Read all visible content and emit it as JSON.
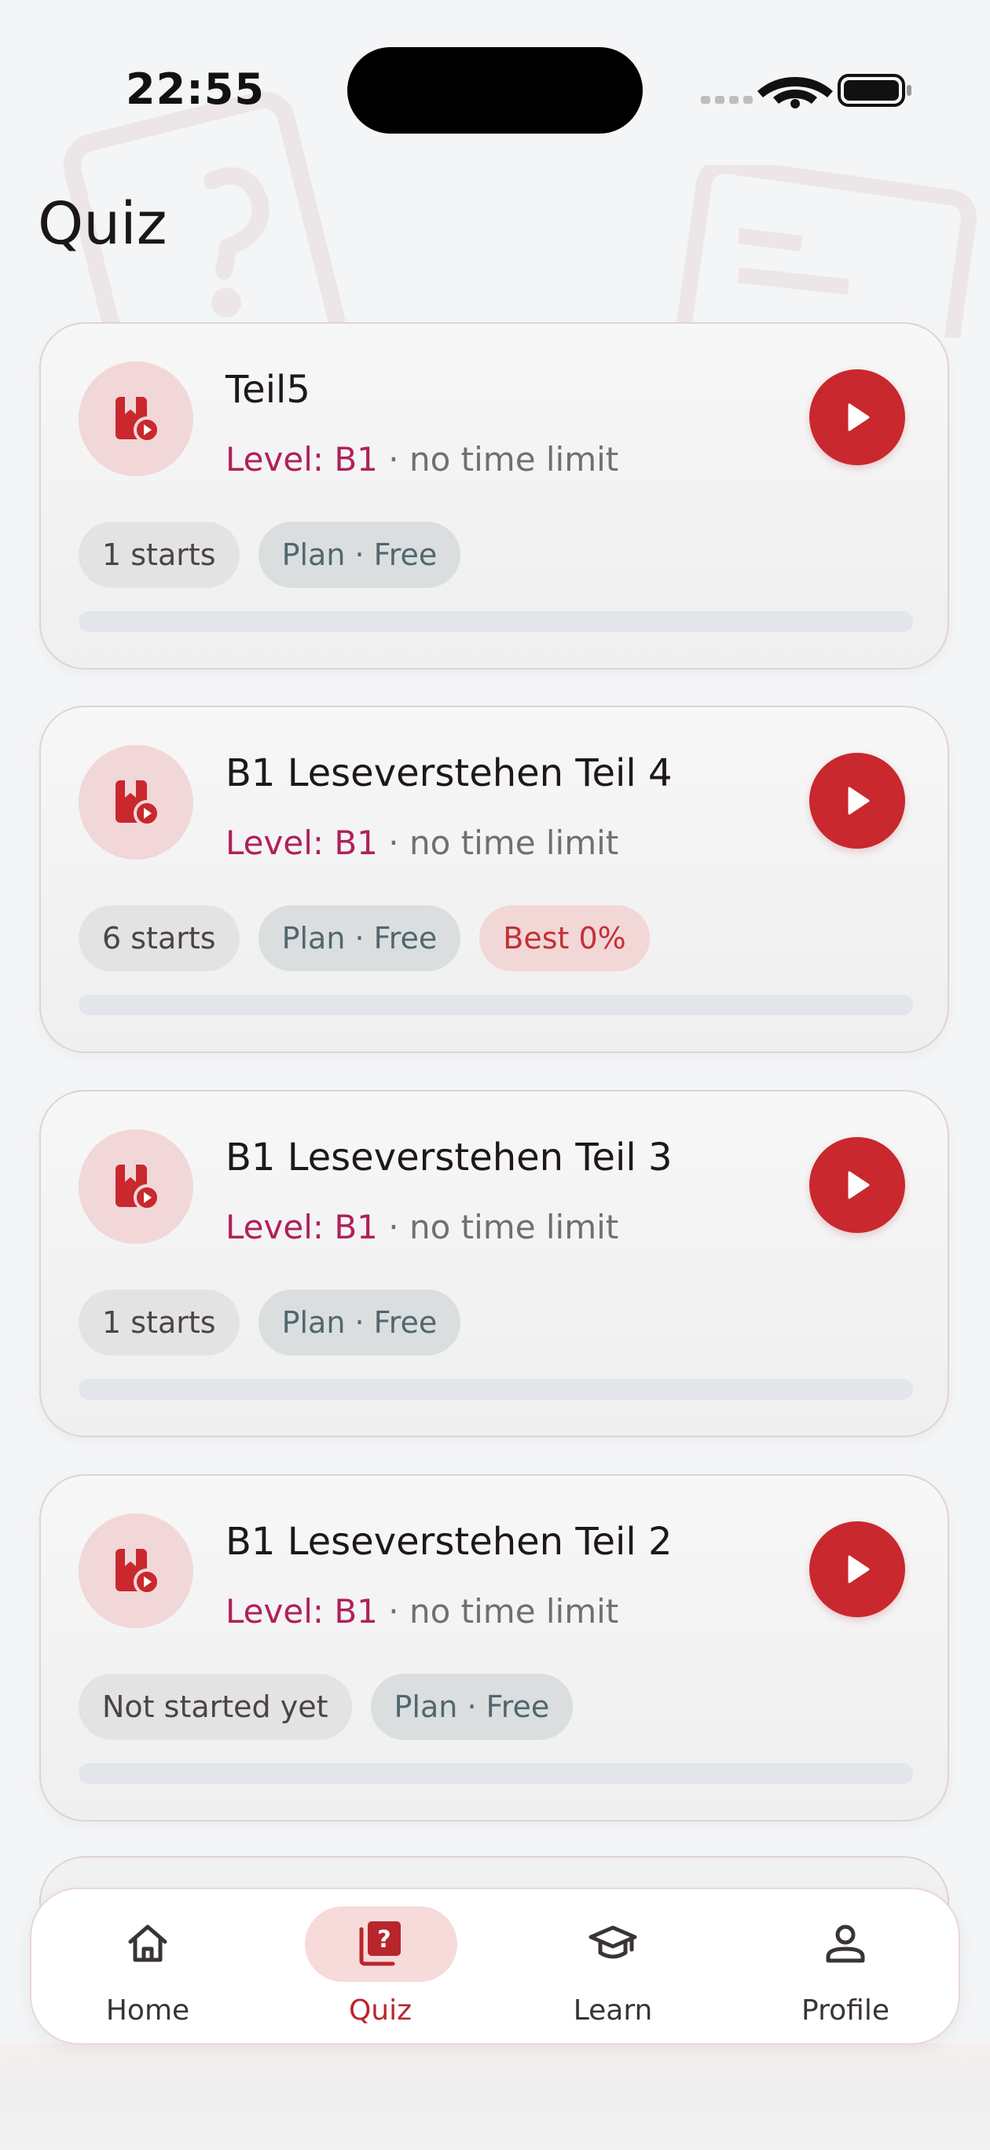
{
  "status_bar": {
    "time": "22:55"
  },
  "page": {
    "title": "Quiz"
  },
  "quizzes": [
    {
      "title": "Teil5",
      "level": "Level: B1",
      "separator": "·",
      "time_limit": "no time limit",
      "starts": "1 starts",
      "plan": "Plan · Free",
      "best": null,
      "progress": 0
    },
    {
      "title": "B1 Leseverstehen Teil 4",
      "level": "Level: B1",
      "separator": "·",
      "time_limit": "no time limit",
      "starts": "6 starts",
      "plan": "Plan · Free",
      "best": "Best 0%",
      "progress": 0
    },
    {
      "title": "B1 Leseverstehen Teil 3",
      "level": "Level: B1",
      "separator": "·",
      "time_limit": "no time limit",
      "starts": "1 starts",
      "plan": "Plan · Free",
      "best": null,
      "progress": 0
    },
    {
      "title": "B1 Leseverstehen Teil 2",
      "level": "Level: B1",
      "separator": "·",
      "time_limit": "no time limit",
      "starts": "Not started yet",
      "plan": "Plan · Free",
      "best": null,
      "progress": 0
    }
  ],
  "nav": {
    "items": [
      {
        "label": "Home",
        "icon": "home-icon",
        "active": false
      },
      {
        "label": "Quiz",
        "icon": "quiz-icon",
        "active": true
      },
      {
        "label": "Learn",
        "icon": "graduation-cap-icon",
        "active": false
      },
      {
        "label": "Profile",
        "icon": "person-icon",
        "active": false
      }
    ]
  },
  "colors": {
    "accent": "#c8282e",
    "level_text": "#b0205a",
    "chip_best_bg": "#f2d7d7",
    "chip_plan_bg": "#dbdedf",
    "background": "#f4f5f7"
  }
}
